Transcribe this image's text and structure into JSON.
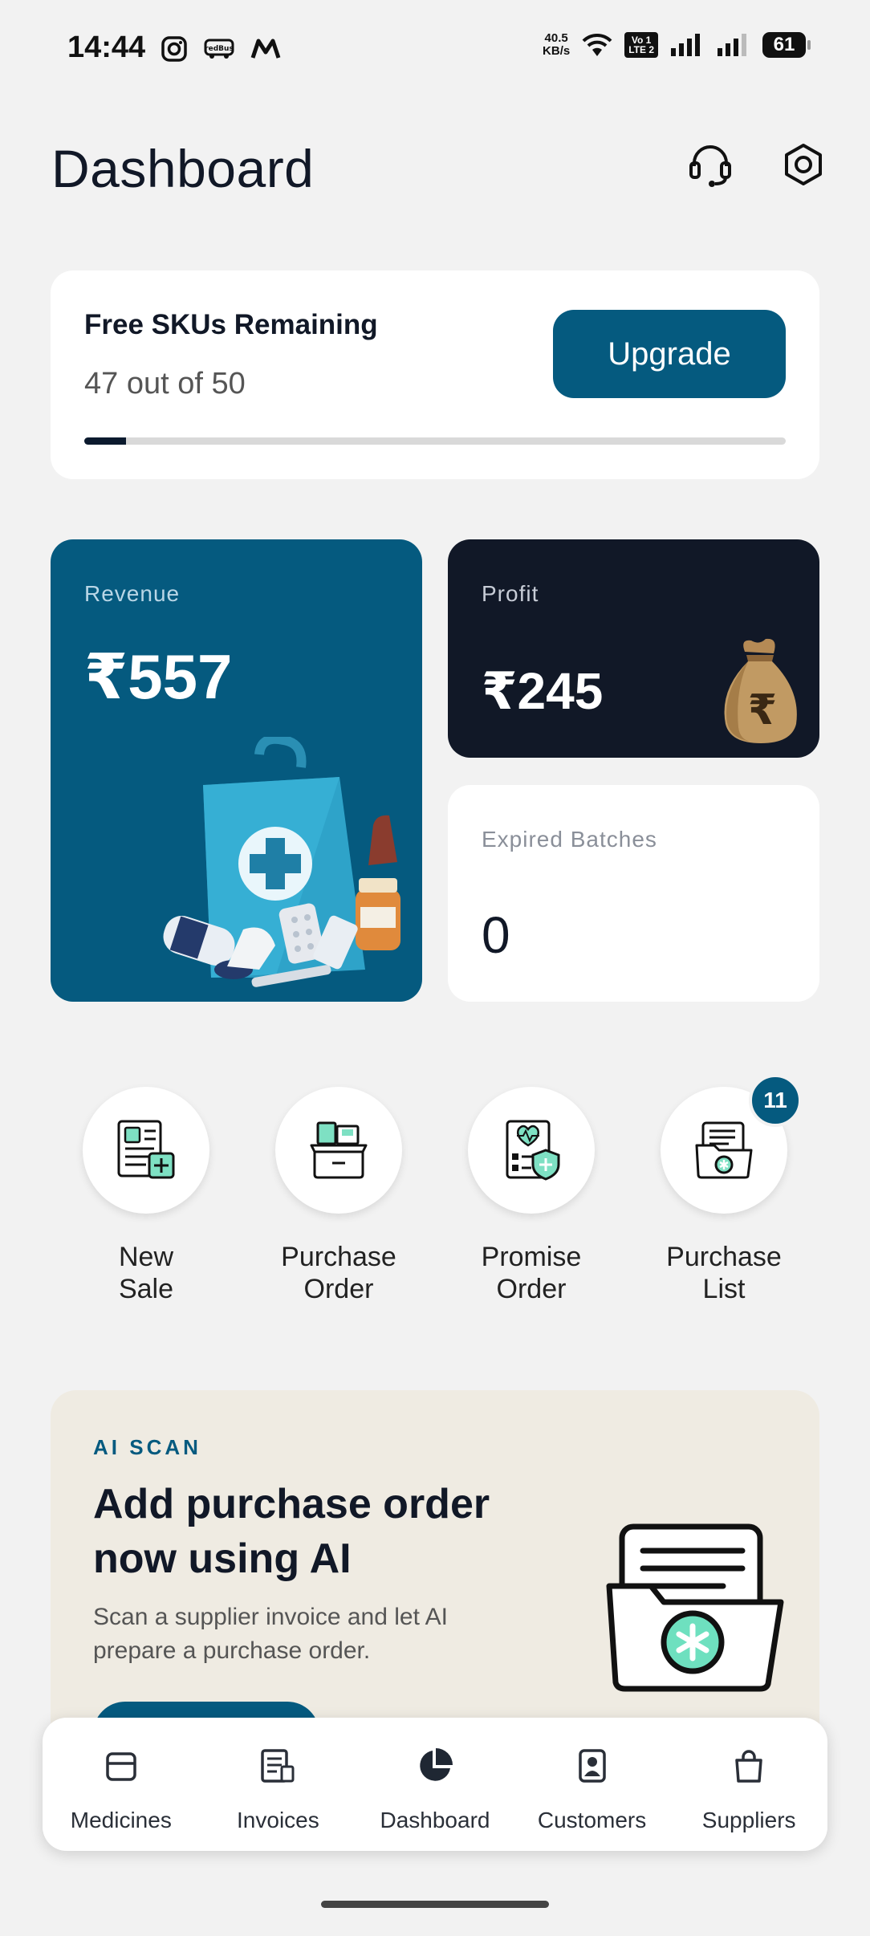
{
  "status_bar": {
    "time": "14:44",
    "net_speed_value": "40.5",
    "net_speed_unit": "KB/s",
    "volte_top": "Vo 1",
    "volte_bottom": "LTE 2",
    "battery": "61",
    "icons": [
      "instagram-icon",
      "redbus-icon",
      "m-app-icon",
      "wifi-icon",
      "signal-icon",
      "signal-icon",
      "battery-icon"
    ],
    "redbus_text": "redBus"
  },
  "header": {
    "title": "Dashboard",
    "icons": [
      "headset-icon",
      "settings-icon"
    ]
  },
  "sku_card": {
    "label": "Free SKUs Remaining",
    "count_text": "47 out of 50",
    "upgrade_label": "Upgrade",
    "progress_fraction": 0.06
  },
  "stats": {
    "revenue": {
      "label": "Revenue",
      "value": "₹557"
    },
    "profit": {
      "label": "Profit",
      "value": "₹245",
      "bag_symbol": "₹"
    },
    "expired": {
      "label": "Expired Batches",
      "value": "0"
    }
  },
  "quick_actions": [
    {
      "line1": "New",
      "line2": "Sale",
      "icon": "invoice-icon"
    },
    {
      "line1": "Purchase",
      "line2": "Order",
      "icon": "box-icon"
    },
    {
      "line1": "Promise",
      "line2": "Order",
      "icon": "health-report-icon"
    },
    {
      "line1": "Purchase",
      "line2": "List",
      "icon": "folder-icon",
      "badge": "11"
    }
  ],
  "ai_scan": {
    "tag": "AI SCAN",
    "heading": "Add purchase order now using AI",
    "description": "Scan a supplier invoice and let AI prepare a purchase order.",
    "icon": "folder-medical-icon"
  },
  "bottom_nav": [
    {
      "label": "Medicines",
      "icon": "medicine-box-icon"
    },
    {
      "label": "Invoices",
      "icon": "invoice-icon"
    },
    {
      "label": "Dashboard",
      "icon": "pie-chart-icon",
      "active": true
    },
    {
      "label": "Customers",
      "icon": "contact-icon"
    },
    {
      "label": "Suppliers",
      "icon": "shopping-bag-icon"
    }
  ],
  "colors": {
    "primary": "#055a7f",
    "dark": "#111827",
    "background": "#f2f2f2",
    "promo_bg": "#efebe2"
  }
}
